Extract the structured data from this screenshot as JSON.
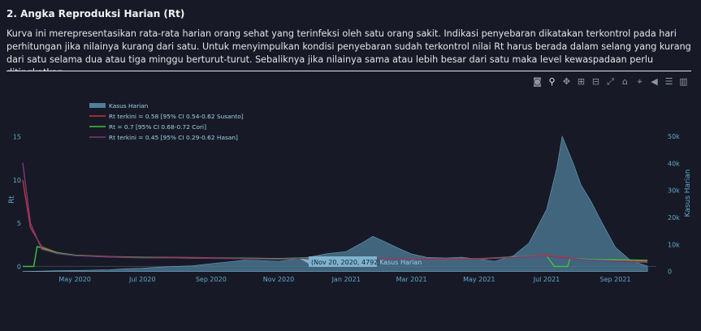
{
  "section": {
    "title": "2. Angka Reproduksi Harian (Rt)",
    "description": "Kurva ini merepresentasikan rata-rata harian orang sehat yang terinfeksi oleh satu orang sakit. Indikasi penyebaran dikatakan terkontrol pada hari perhitungan jika nilainya kurang dari satu. Untuk menyimpulkan kondisi penyebaran sudah terkontrol nilai Rt harus berada dalam selang yang kurang dari satu selama dua atau tiga minggu berturut-turut. Sebaliknya jika nilainya sama atau lebih besar dari satu maka level kewaspadaan perlu ditingkatkan."
  },
  "modebar": [
    {
      "name": "camera-icon",
      "glyph": "◙"
    },
    {
      "name": "zoom-icon",
      "glyph": "⚲"
    },
    {
      "name": "pan-icon",
      "glyph": "✥"
    },
    {
      "name": "zoom-in-icon",
      "glyph": "⊞"
    },
    {
      "name": "zoom-out-icon",
      "glyph": "⊟"
    },
    {
      "name": "autoscale-icon",
      "glyph": "⤢"
    },
    {
      "name": "reset-axes-icon",
      "glyph": "⌂"
    },
    {
      "name": "spike-lines-icon",
      "glyph": "⌖"
    },
    {
      "name": "hover-closest-icon",
      "glyph": "◀"
    },
    {
      "name": "hover-compare-icon",
      "glyph": "☰"
    },
    {
      "name": "plotly-logo-icon",
      "glyph": "▥"
    }
  ],
  "hover": {
    "label": "(Nov 20, 2020, 4792)",
    "series": "Kasus Harian"
  },
  "chart_data": {
    "type": "line",
    "xlabel": "",
    "ylabel": "Rt",
    "y2label": "Kasus Harian",
    "ylim": [
      -0.9,
      16
    ],
    "y2lim": [
      -1000,
      53000
    ],
    "xticks": [
      "May 2020",
      "Jul 2020",
      "Sep 2020",
      "Nov 2020",
      "Jan 2021",
      "Mar 2021",
      "May 2021",
      "Jul 2021",
      "Sep 2021"
    ],
    "yticks": [
      "0",
      "5",
      "10",
      "15"
    ],
    "y2ticks": [
      "0",
      "10k",
      "20k",
      "30k",
      "40k",
      "50k"
    ],
    "legend_position": "top-left",
    "colors": {
      "cases": "#4f7f9a",
      "susanto": "#c0363a",
      "cori": "#3ec23e",
      "hasan": "#7a3a7a",
      "hover_bg": "#7fb2cf"
    },
    "series": [
      {
        "name": "Kasus Harian",
        "kind": "area",
        "axis": "y2",
        "points": [
          [
            "2020-03-15",
            20
          ],
          [
            "2020-04-01",
            150
          ],
          [
            "2020-04-15",
            300
          ],
          [
            "2020-05-01",
            400
          ],
          [
            "2020-05-15",
            500
          ],
          [
            "2020-06-01",
            650
          ],
          [
            "2020-06-15",
            1000
          ],
          [
            "2020-07-01",
            1200
          ],
          [
            "2020-07-15",
            1600
          ],
          [
            "2020-08-01",
            1900
          ],
          [
            "2020-08-15",
            2100
          ],
          [
            "2020-09-01",
            2900
          ],
          [
            "2020-09-15",
            3500
          ],
          [
            "2020-10-01",
            4200
          ],
          [
            "2020-10-15",
            4100
          ],
          [
            "2020-11-01",
            3800
          ],
          [
            "2020-11-20",
            4792
          ],
          [
            "2020-12-01",
            5500
          ],
          [
            "2020-12-15",
            6600
          ],
          [
            "2021-01-01",
            7400
          ],
          [
            "2021-01-15",
            10500
          ],
          [
            "2021-01-25",
            13000
          ],
          [
            "2021-02-05",
            11000
          ],
          [
            "2021-02-15",
            9000
          ],
          [
            "2021-03-01",
            6500
          ],
          [
            "2021-03-15",
            5200
          ],
          [
            "2021-04-01",
            5000
          ],
          [
            "2021-04-15",
            5300
          ],
          [
            "2021-05-01",
            4500
          ],
          [
            "2021-05-15",
            3800
          ],
          [
            "2021-06-01",
            5800
          ],
          [
            "2021-06-15",
            10500
          ],
          [
            "2021-07-01",
            23000
          ],
          [
            "2021-07-10",
            38000
          ],
          [
            "2021-07-15",
            50000
          ],
          [
            "2021-07-25",
            40000
          ],
          [
            "2021-08-01",
            32000
          ],
          [
            "2021-08-10",
            26000
          ],
          [
            "2021-08-20",
            18000
          ],
          [
            "2021-09-01",
            9000
          ],
          [
            "2021-09-15",
            4000
          ],
          [
            "2021-09-30",
            2000
          ]
        ]
      },
      {
        "name": "Rt terkini = 0.58 [95% CI 0.54-0.62 Susanto]",
        "kind": "line",
        "axis": "y",
        "points": [
          [
            "2020-03-15",
            10
          ],
          [
            "2020-03-22",
            4.5
          ],
          [
            "2020-04-01",
            2.3
          ],
          [
            "2020-04-15",
            1.6
          ],
          [
            "2020-05-01",
            1.3
          ],
          [
            "2020-06-01",
            1.15
          ],
          [
            "2020-07-01",
            1.05
          ],
          [
            "2020-08-01",
            1.05
          ],
          [
            "2020-09-01",
            1.0
          ],
          [
            "2020-10-01",
            0.95
          ],
          [
            "2020-11-01",
            0.9
          ],
          [
            "2020-12-01",
            1.0
          ],
          [
            "2021-01-01",
            1.05
          ],
          [
            "2021-02-01",
            0.95
          ],
          [
            "2021-03-01",
            0.85
          ],
          [
            "2021-04-01",
            0.9
          ],
          [
            "2021-05-01",
            0.9
          ],
          [
            "2021-06-01",
            1.1
          ],
          [
            "2021-07-01",
            1.3
          ],
          [
            "2021-08-01",
            0.85
          ],
          [
            "2021-09-01",
            0.65
          ],
          [
            "2021-09-30",
            0.58
          ]
        ]
      },
      {
        "name": "Rt = 0.7 [95% CI 0.68-0.72 Cori]",
        "kind": "line",
        "axis": "y",
        "points": [
          [
            "2020-03-15",
            0.0
          ],
          [
            "2020-03-25",
            0.0
          ],
          [
            "2020-03-28",
            2.3
          ],
          [
            "2020-04-15",
            1.6
          ],
          [
            "2020-05-01",
            1.3
          ],
          [
            "2020-06-01",
            1.1
          ],
          [
            "2020-07-01",
            1.05
          ],
          [
            "2020-08-01",
            1.0
          ],
          [
            "2020-09-01",
            0.95
          ],
          [
            "2020-10-01",
            0.95
          ],
          [
            "2020-11-01",
            0.9
          ],
          [
            "2020-12-01",
            1.0
          ],
          [
            "2021-01-01",
            1.05
          ],
          [
            "2021-02-01",
            0.9
          ],
          [
            "2021-03-01",
            0.8
          ],
          [
            "2021-04-01",
            0.85
          ],
          [
            "2021-05-01",
            0.85
          ],
          [
            "2021-06-01",
            1.1
          ],
          [
            "2021-07-01",
            1.2
          ],
          [
            "2021-07-08",
            0.0
          ],
          [
            "2021-07-20",
            0.0
          ],
          [
            "2021-07-22",
            0.9
          ],
          [
            "2021-08-15",
            0.8
          ],
          [
            "2021-09-15",
            0.75
          ],
          [
            "2021-09-30",
            0.7
          ]
        ]
      },
      {
        "name": "Rt terkini = 0.45 [95% CI 0.29-0.62 Hasan]",
        "kind": "line",
        "axis": "y",
        "points": [
          [
            "2020-03-15",
            12
          ],
          [
            "2020-03-22",
            5
          ],
          [
            "2020-04-01",
            2.0
          ],
          [
            "2020-04-15",
            1.5
          ],
          [
            "2020-05-01",
            1.25
          ],
          [
            "2020-06-01",
            1.1
          ],
          [
            "2020-07-01",
            1.0
          ],
          [
            "2020-08-01",
            1.0
          ],
          [
            "2020-09-01",
            0.95
          ],
          [
            "2020-10-01",
            0.9
          ],
          [
            "2020-11-01",
            0.85
          ],
          [
            "2020-12-01",
            0.95
          ],
          [
            "2021-01-01",
            1.0
          ],
          [
            "2021-02-01",
            0.9
          ],
          [
            "2021-03-01",
            0.8
          ],
          [
            "2021-04-01",
            0.85
          ],
          [
            "2021-05-01",
            0.85
          ],
          [
            "2021-06-01",
            1.05
          ],
          [
            "2021-07-01",
            1.2
          ],
          [
            "2021-08-01",
            0.8
          ],
          [
            "2021-09-01",
            0.6
          ],
          [
            "2021-09-30",
            0.45
          ]
        ]
      }
    ]
  }
}
